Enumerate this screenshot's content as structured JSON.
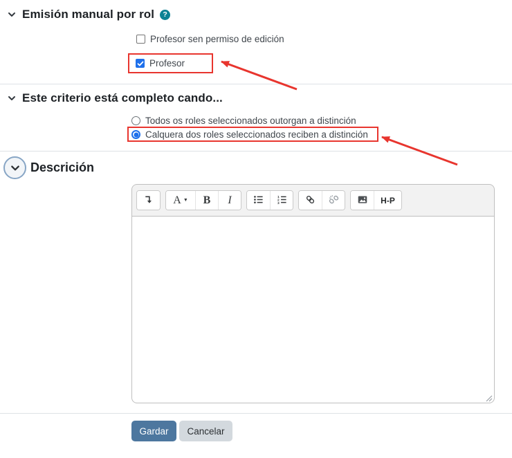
{
  "colors": {
    "annotation_red": "#e8352e",
    "control_blue": "#1e70eb",
    "help_teal": "#0d8294",
    "primary_button_blue": "#4d779f",
    "secondary_button_gray": "#d3d9de",
    "divider_gray": "#dee2e6"
  },
  "sections": [
    {
      "id": "manual-issue",
      "title": "Emisión manual por rol",
      "help_icon": "?",
      "checkboxes": [
        {
          "label": "Profesor sen permiso de edición",
          "checked": false,
          "highlighted": false
        },
        {
          "label": "Profesor",
          "checked": true,
          "highlighted": true
        }
      ]
    },
    {
      "id": "criteria-complete",
      "title": "Este criterio está completo cando...",
      "radios": [
        {
          "label": "Todos os roles seleccionados outorgan a distinción",
          "selected": false,
          "highlighted": false
        },
        {
          "label": "Calquera dos roles seleccionados reciben a distinción",
          "selected": true,
          "highlighted": true
        }
      ]
    },
    {
      "id": "description",
      "title": "Descrición"
    }
  ],
  "annotations": [
    {
      "type": "red-arrow",
      "points_to": "profesor-checkbox"
    },
    {
      "type": "red-arrow",
      "points_to": "calquera-radio"
    }
  ],
  "editor": {
    "content": "",
    "toolbar": {
      "collapse_icon": "level-down-arrow",
      "font_label": "A",
      "bold_label": "B",
      "italic_label": "I",
      "unordered_list_icon": "bullet-list",
      "ordered_list_icon": "numbered-list",
      "link_icon": "chain-link",
      "unlink_icon": "broken-chain-link",
      "image_icon": "picture",
      "h5p_label": "H-P"
    }
  },
  "buttons": {
    "save": "Gardar",
    "cancel": "Cancelar"
  }
}
